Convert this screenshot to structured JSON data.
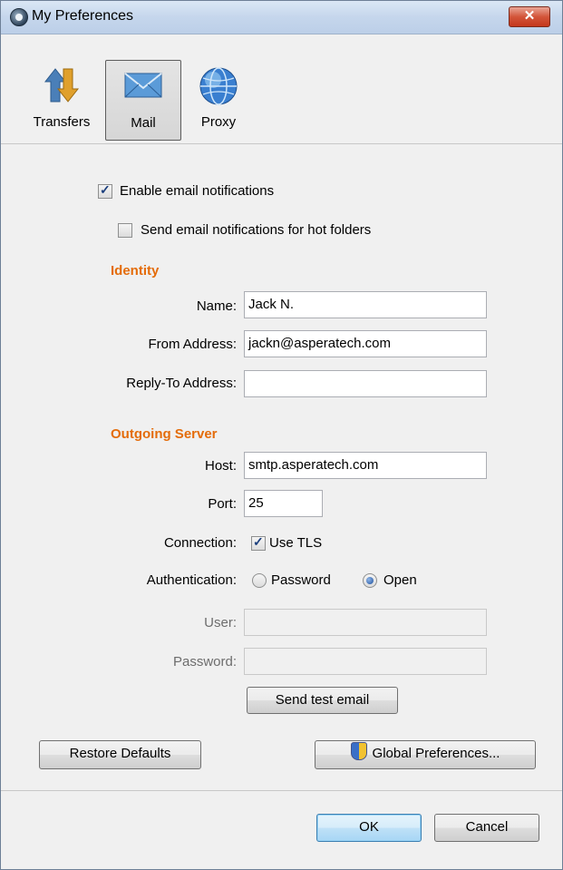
{
  "window": {
    "title": "My Preferences",
    "close_label": "✕"
  },
  "toolbar": {
    "items": [
      {
        "label": "Transfers",
        "icon": "transfers-icon",
        "selected": false
      },
      {
        "label": "Mail",
        "icon": "mail-icon",
        "selected": true
      },
      {
        "label": "Proxy",
        "icon": "proxy-globe-icon",
        "selected": false
      }
    ]
  },
  "notifications": {
    "enable_label": "Enable email notifications",
    "enable_checked": true,
    "hot_folders_label": "Send email notifications for hot folders",
    "hot_folders_checked": false
  },
  "identity": {
    "section_title": "Identity",
    "name_label": "Name:",
    "name_value": "Jack N.",
    "from_label": "From Address:",
    "from_value": "jackn@asperatech.com",
    "reply_label": "Reply-To Address:",
    "reply_value": ""
  },
  "server": {
    "section_title": "Outgoing Server",
    "host_label": "Host:",
    "host_value": "smtp.asperatech.com",
    "port_label": "Port:",
    "port_value": "25",
    "connection_label": "Connection:",
    "tls_label": "Use TLS",
    "tls_checked": true,
    "auth_label": "Authentication:",
    "auth_password_label": "Password",
    "auth_open_label": "Open",
    "auth_selected": "Open",
    "user_label": "User:",
    "user_value": "",
    "password_label": "Password:",
    "password_value": "",
    "test_button": "Send test email"
  },
  "buttons": {
    "restore_defaults": "Restore Defaults",
    "global_preferences": "Global Preferences...",
    "ok": "OK",
    "cancel": "Cancel"
  },
  "colors": {
    "section_heading": "#e46c0a",
    "titlebar": "#c5d6ec",
    "close_button": "#d3553a"
  }
}
